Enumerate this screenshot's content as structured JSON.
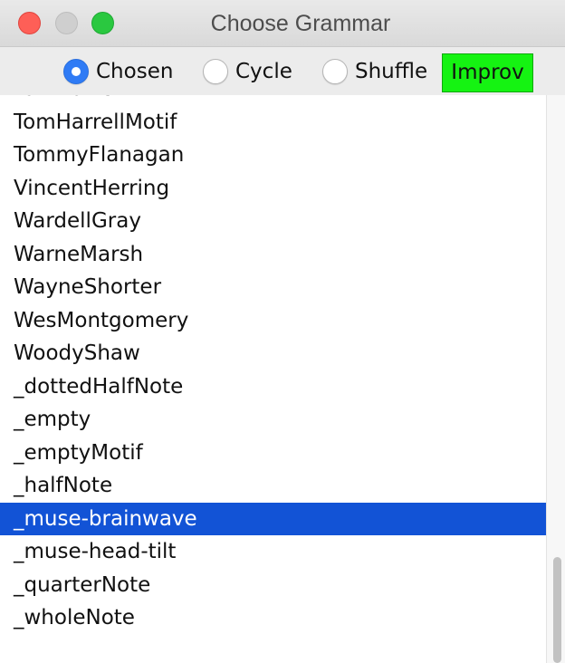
{
  "window": {
    "title": "Choose Grammar"
  },
  "toolbar": {
    "radios": [
      {
        "label": "Chosen",
        "checked": true
      },
      {
        "label": "Cycle",
        "checked": false
      },
      {
        "label": "Shuffle",
        "checked": false
      }
    ],
    "improv_label": "Improv",
    "improv_color": "#15f312"
  },
  "list": {
    "items": [
      "TomHarrell",
      "TomHarrellMotif",
      "TommyFlanagan",
      "VincentHerring",
      "WardellGray",
      "WarneMarsh",
      "WayneShorter",
      "WesMontgomery",
      "WoodyShaw",
      "_dottedHalfNote",
      "_empty",
      "_emptyMotif",
      "_halfNote",
      "_muse-brainwave",
      "_muse-head-tilt",
      "_quarterNote",
      "_wholeNote"
    ],
    "selected_item": "_muse-brainwave",
    "selection_color": "#1253d6"
  }
}
